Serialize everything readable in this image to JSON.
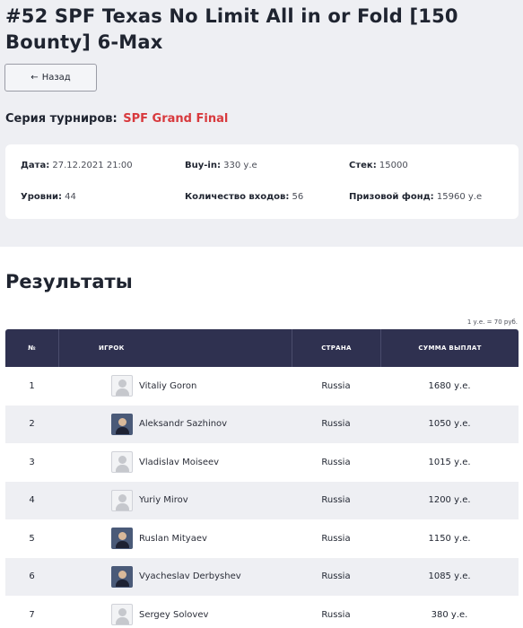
{
  "page": {
    "title": "#52 SPF Texas No Limit All in or Fold [150 Bounty] 6-Max",
    "back_label": "Назад",
    "back_arrow": "←",
    "series_label": "Серия турниров:",
    "series_name": "SPF Grand Final"
  },
  "info": {
    "date_label": "Дата:",
    "date_value": "27.12.2021 21:00",
    "buyin_label": "Buy-in:",
    "buyin_value": "330 у.е",
    "stack_label": "Стек:",
    "stack_value": "15000",
    "levels_label": "Уровни:",
    "levels_value": "44",
    "entries_label": "Количество входов:",
    "entries_value": "56",
    "prize_label": "Призовой фонд:",
    "prize_value": "15960 у.е"
  },
  "results": {
    "title": "Результаты",
    "rate": "1 у.е. = 70 руб.",
    "headers": {
      "num": "№",
      "player": "ИГРОК",
      "country": "СТРАНА",
      "sum": "СУММА ВЫПЛАТ"
    },
    "rows": [
      {
        "num": "1",
        "name": "Vitaliy Goron",
        "country": "Russia",
        "sum": "1680 у.е.",
        "photo": false
      },
      {
        "num": "2",
        "name": "Aleksandr Sazhinov",
        "country": "Russia",
        "sum": "1050 у.е.",
        "photo": true
      },
      {
        "num": "3",
        "name": "Vladislav Moiseev",
        "country": "Russia",
        "sum": "1015 у.е.",
        "photo": false
      },
      {
        "num": "4",
        "name": "Yuriy Mirov",
        "country": "Russia",
        "sum": "1200 у.е.",
        "photo": false
      },
      {
        "num": "5",
        "name": "Ruslan Mityaev",
        "country": "Russia",
        "sum": "1150 у.е.",
        "photo": true
      },
      {
        "num": "6",
        "name": "Vyacheslav Derbyshev",
        "country": "Russia",
        "sum": "1085 у.е.",
        "photo": true
      },
      {
        "num": "7",
        "name": "Sergey Solovev",
        "country": "Russia",
        "sum": "380 у.е.",
        "photo": false
      }
    ]
  }
}
